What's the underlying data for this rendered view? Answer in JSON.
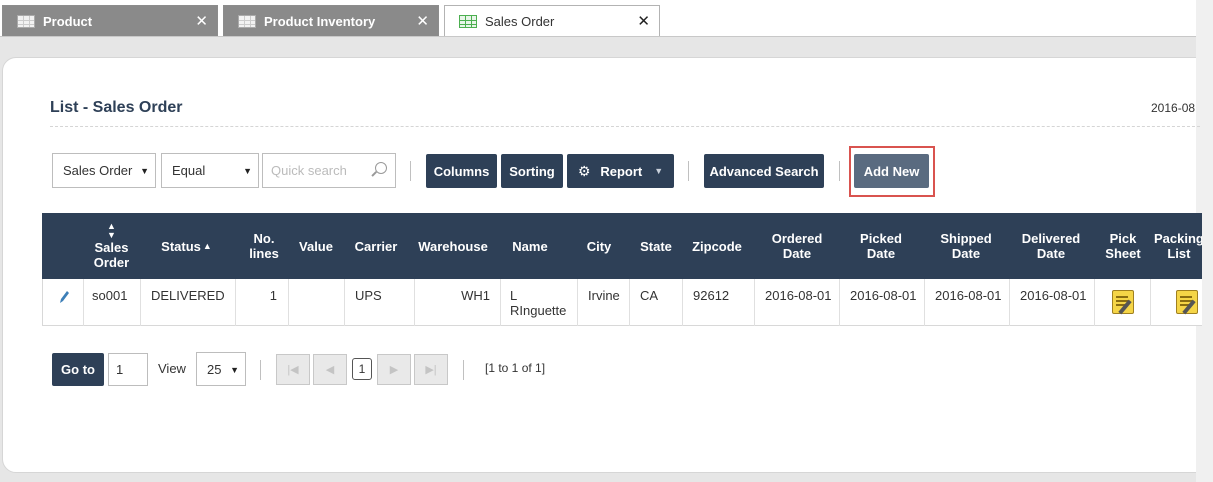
{
  "tabs": [
    {
      "label": "Product",
      "close": "✕"
    },
    {
      "label": "Product Inventory",
      "close": "✕"
    },
    {
      "label": "Sales Order",
      "close": "✕"
    }
  ],
  "page": {
    "title": "List - Sales Order",
    "date": "2016-08"
  },
  "toolbar": {
    "field_select": "Sales Order",
    "operator_select": "Equal",
    "quick_search_placeholder": "Quick search",
    "columns": "Columns",
    "sorting": "Sorting",
    "report": "Report",
    "advanced_search": "Advanced Search",
    "add_new": "Add New"
  },
  "table": {
    "headers": {
      "sales_order": "Sales Order",
      "status": "Status",
      "no_lines": "No. lines",
      "value": "Value",
      "carrier": "Carrier",
      "warehouse": "Warehouse",
      "name": "Name",
      "city": "City",
      "state": "State",
      "zipcode": "Zipcode",
      "ordered_date": "Ordered Date",
      "picked_date": "Picked Date",
      "shipped_date": "Shipped Date",
      "delivered_date": "Delivered Date",
      "pick_sheet": "Pick Sheet",
      "packing_list": "Packing List"
    },
    "rows": [
      {
        "sales_order": "so001",
        "status": "DELIVERED",
        "no_lines": "1",
        "value": "",
        "carrier": "UPS",
        "warehouse": "WH1",
        "name": "L RInguette",
        "city": "Irvine",
        "state": "CA",
        "zipcode": "92612",
        "ordered_date": "2016-08-01",
        "picked_date": "2016-08-01",
        "shipped_date": "2016-08-01",
        "delivered_date": "2016-08-01"
      }
    ]
  },
  "pager": {
    "goto": "Go to",
    "page_value": "1",
    "view_label": "View",
    "page_size": "25",
    "current_page": "1",
    "info": "[1 to 1 of 1]"
  }
}
